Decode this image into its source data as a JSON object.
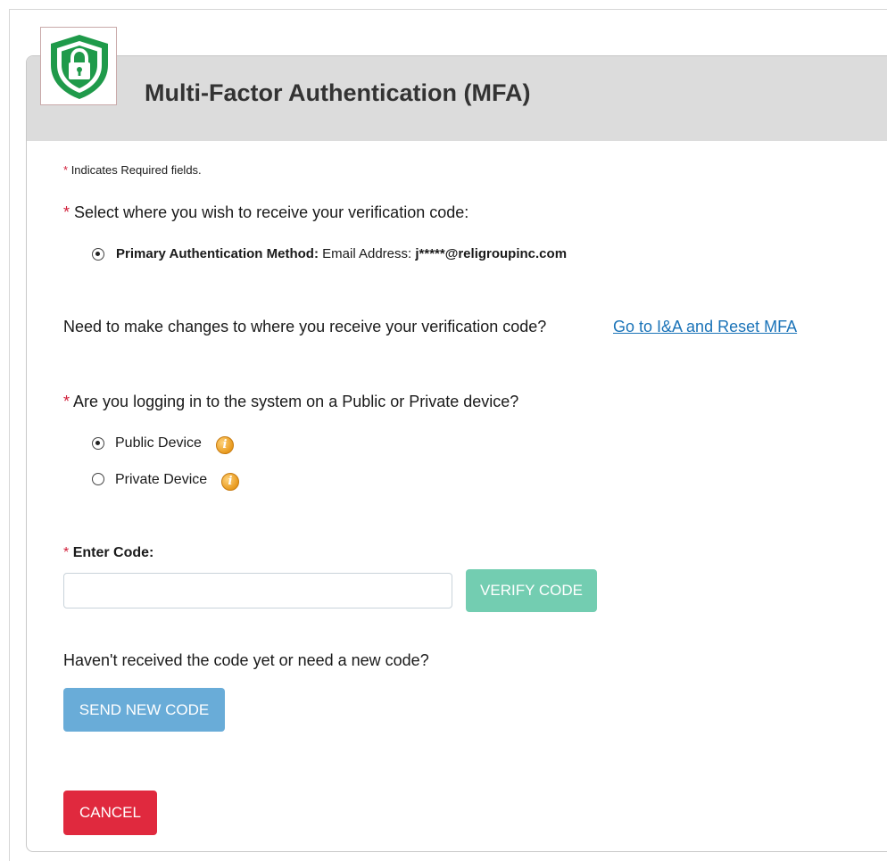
{
  "header": {
    "title": "Multi-Factor Authentication (MFA)",
    "logo_icon": "shield-lock-icon"
  },
  "required_note": {
    "asterisk": "*",
    "text": "Indicates Required fields."
  },
  "delivery": {
    "asterisk": "*",
    "question": "Select where you wish to receive your verification code:",
    "option": {
      "label": "Primary Authentication Method:",
      "detail": "Email Address:",
      "value": "j*****@religroupinc.com",
      "selected": true
    }
  },
  "changes": {
    "text": "Need to make changes to where you receive your verification code?",
    "link": "Go to I&A and Reset MFA"
  },
  "device": {
    "asterisk": "*",
    "question": "Are you logging in to the system on a Public or Private device?",
    "options": [
      {
        "label": "Public Device",
        "selected": true
      },
      {
        "label": "Private Device",
        "selected": false
      }
    ],
    "info_icon_glyph": "i"
  },
  "code": {
    "asterisk": "*",
    "label": "Enter Code:",
    "value": "",
    "placeholder": "",
    "verify_button": "VERIFY CODE"
  },
  "resend": {
    "text": "Haven't received the code yet or need a new code?",
    "button": "SEND NEW CODE"
  },
  "cancel_button": "CANCEL",
  "colors": {
    "required": "#d11f3a",
    "link": "#1a73b8",
    "verify": "#73cdb1",
    "send": "#69acd8",
    "cancel": "#e0293e",
    "shield": "#1f9a4a"
  }
}
